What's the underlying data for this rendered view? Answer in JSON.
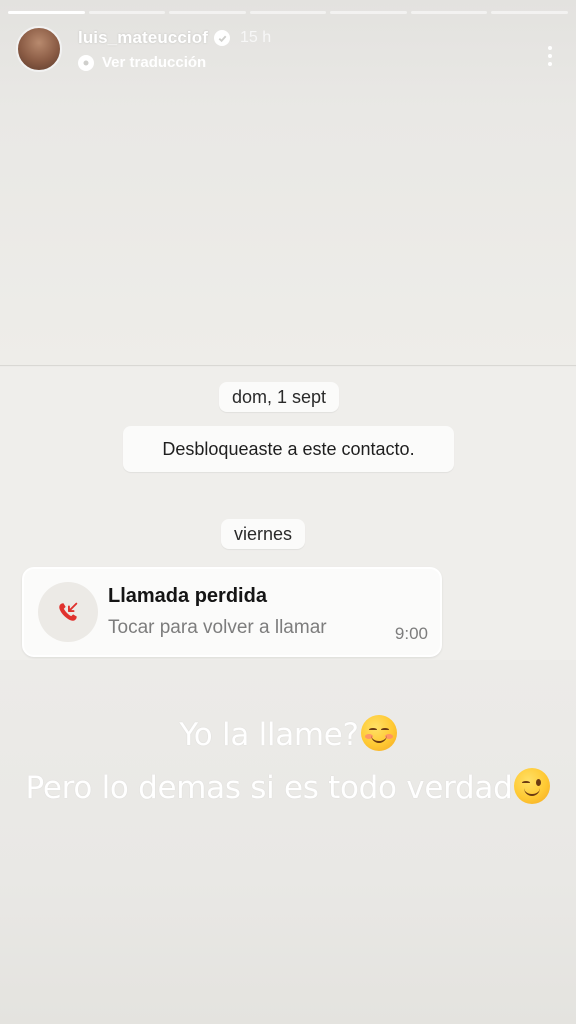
{
  "story": {
    "segments_total": 7,
    "segments_done": 1,
    "username": "luis_mateucciof",
    "time_ago": "15 h",
    "translate_label": "Ver traducción"
  },
  "chat": {
    "date_chip_1": "dom, 1 sept",
    "system_message": "Desbloqueaste a este contacto.",
    "date_chip_2": "viernes",
    "missed_call": {
      "title": "Llamada perdida",
      "subtitle": "Tocar para volver a llamar",
      "time": "9:00"
    }
  },
  "caption": {
    "line1": "Yo la llame?",
    "line1_emoji": "smiling-face-emoji",
    "line2": "Pero lo demas si es todo verdad",
    "line2_emoji": "winking-face-emoji"
  },
  "colors": {
    "missed_call_red": "#e0322e",
    "background": "#ecebe8"
  }
}
